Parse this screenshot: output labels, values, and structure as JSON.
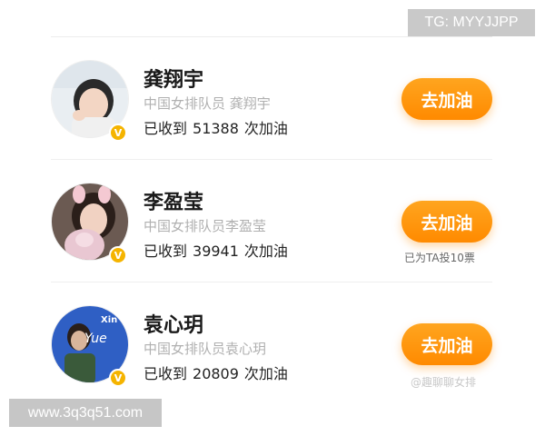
{
  "players": [
    {
      "name": "龚翔宇",
      "title": "中国女排队员 龚翔宇",
      "received_prefix": "已收到",
      "count": "51388",
      "received_suffix": "次加油",
      "button_label": "去加油",
      "note": ""
    },
    {
      "name": "李盈莹",
      "title": "中国女排队员李盈莹",
      "received_prefix": "已收到",
      "count": "39941",
      "received_suffix": "次加油",
      "button_label": "去加油",
      "note": "已为TA投10票"
    },
    {
      "name": "袁心玥",
      "title": "中国女排队员袁心玥",
      "received_prefix": "已收到",
      "count": "20809",
      "received_suffix": "次加油",
      "button_label": "去加油",
      "note": ""
    }
  ],
  "avatar_text": {
    "line1": "Xin",
    "line2": "Yue"
  },
  "verified_mark": "V",
  "watermarks": {
    "tg": "TG: MYYJJPP",
    "url": "www.3q3q51.com",
    "source": "@趣聊聊女排"
  },
  "colors": {
    "button_orange": "#ff9500",
    "verified_gold": "#f5b400",
    "muted_text": "#b0b0b0"
  }
}
